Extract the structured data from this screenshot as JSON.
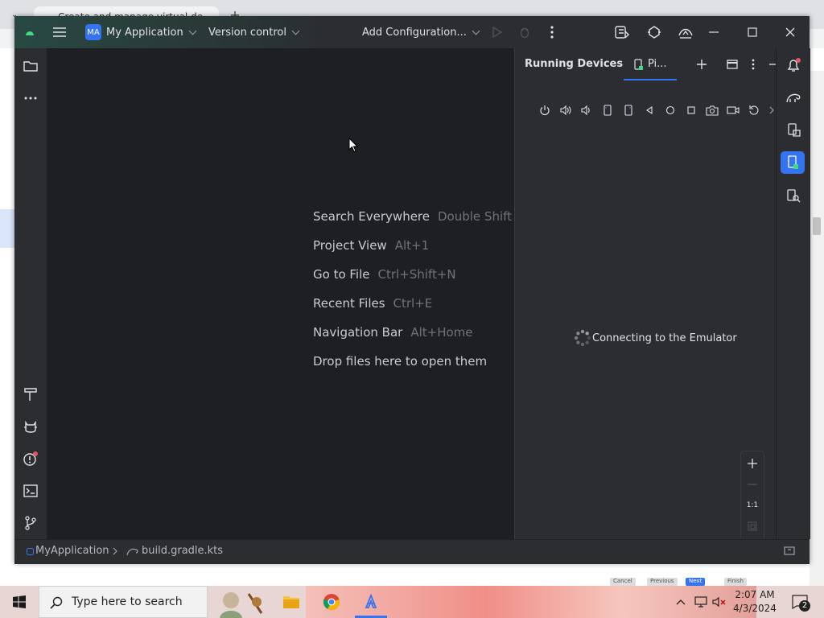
{
  "browser": {
    "tab_title": "Create and manage virtual de"
  },
  "titlebar": {
    "project_badge": "MA",
    "project_name": "My Application",
    "vcs": "Version control",
    "run_config": "Add Configuration..."
  },
  "editor": {
    "hints": [
      {
        "label": "Search Everywhere",
        "shortcut": "Double Shift"
      },
      {
        "label": "Project View",
        "shortcut": "Alt+1"
      },
      {
        "label": "Go to File",
        "shortcut": "Ctrl+Shift+N"
      },
      {
        "label": "Recent Files",
        "shortcut": "Ctrl+E"
      },
      {
        "label": "Navigation Bar",
        "shortcut": "Alt+Home"
      },
      {
        "label": "Drop files here to open them",
        "shortcut": ""
      }
    ]
  },
  "running_devices": {
    "title": "Running Devices",
    "tab_label": "Pi...",
    "status": "Connecting to the Emulator",
    "zoom_actual": "1:1"
  },
  "statusbar": {
    "project": "MyApplication",
    "file": "build.gradle.kts"
  },
  "wizard_behind": {
    "cancel": "Cancel",
    "previous": "Previous",
    "next": "Next",
    "finish": "Finish"
  },
  "taskbar": {
    "search_placeholder": "Type here to search",
    "time": "2:07 AM",
    "date": "4/3/2024",
    "notifications": "2"
  },
  "colors": {
    "accent": "#3574f0",
    "ide_background": "#2b2d30",
    "editor_background": "#1e1f22",
    "notification_dot": "#e55765"
  }
}
